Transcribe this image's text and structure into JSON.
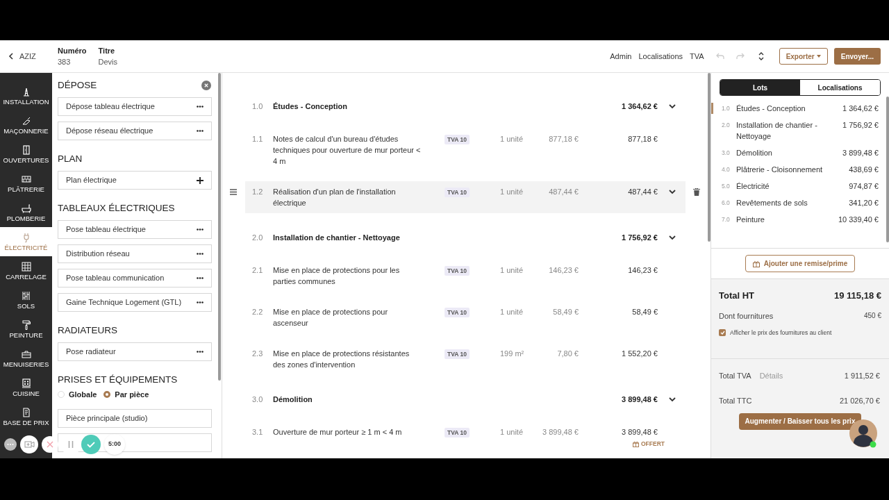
{
  "header": {
    "back_label": "AZIZ",
    "fields": [
      {
        "label": "Numéro",
        "value": "383"
      },
      {
        "label": "Titre",
        "value": "Devis"
      }
    ],
    "links": [
      "Admin",
      "Localisations",
      "TVA"
    ],
    "export_button": "Exporter",
    "send_button": "Envoyer..."
  },
  "nav": [
    {
      "label": "INSTALLATION",
      "selected": false
    },
    {
      "label": "MAÇONNERIE",
      "selected": false
    },
    {
      "label": "OUVERTURES",
      "selected": false
    },
    {
      "label": "PLÂTRERIE",
      "selected": false
    },
    {
      "label": "PLOMBERIE",
      "selected": false
    },
    {
      "label": "ÉLECTRICITÉ",
      "selected": true
    },
    {
      "label": "CARRELAGE",
      "selected": false
    },
    {
      "label": "SOLS",
      "selected": false
    },
    {
      "label": "PEINTURE",
      "selected": false
    },
    {
      "label": "MENUISERIES",
      "selected": false
    },
    {
      "label": "CUISINE",
      "selected": false
    },
    {
      "label": "BASE DE PRIX",
      "selected": false
    }
  ],
  "catalog": {
    "sections": [
      {
        "title": "DÉPOSE",
        "closable": true,
        "items": [
          {
            "label": "Dépose tableau électrique",
            "kind": "menu"
          },
          {
            "label": "Dépose réseau électrique",
            "kind": "menu"
          }
        ]
      },
      {
        "title": "PLAN",
        "closable": false,
        "items": [
          {
            "label": "Plan électrique",
            "kind": "add"
          }
        ]
      },
      {
        "title": "TABLEAUX ÉLECTRIQUES",
        "closable": false,
        "items": [
          {
            "label": "Pose tableau électrique",
            "kind": "menu"
          },
          {
            "label": "Distribution réseau",
            "kind": "menu"
          },
          {
            "label": "Pose tableau communication",
            "kind": "menu"
          },
          {
            "label": "Gaine Technique Logement (GTL)",
            "kind": "menu"
          }
        ]
      },
      {
        "title": "RADIATEURS",
        "closable": false,
        "items": [
          {
            "label": "Pose radiateur",
            "kind": "menu"
          }
        ]
      },
      {
        "title": "PRISES ET ÉQUIPEMENTS",
        "closable": false,
        "options": [
          {
            "label": "Globale",
            "selected": false
          },
          {
            "label": "Par pièce",
            "selected": true
          }
        ],
        "items": [
          {
            "label": "Pièce principale (studio)",
            "kind": "field"
          },
          {
            "kind": "field"
          }
        ]
      }
    ]
  },
  "lines": [
    {
      "kind": "lot",
      "number": "1.0",
      "title": "Études - Conception",
      "total": "1 364,62 €"
    },
    {
      "kind": "item",
      "number": "1.1",
      "title": "Notes de calcul d'un bureau d'études techniques pour ouverture de mur porteur < 4 m",
      "tva": "TVA 10",
      "quantity": "1 unité",
      "unit_price": "877,18 €",
      "total": "877,18 €",
      "hovered": false
    },
    {
      "kind": "item",
      "number": "1.2",
      "title": "Réalisation d'un plan de l'installation électrique",
      "tva": "TVA 10",
      "quantity": "1 unité",
      "unit_price": "487,44 €",
      "total": "487,44 €",
      "hovered": true
    },
    {
      "kind": "lot",
      "number": "2.0",
      "title": "Installation de chantier - Nettoyage",
      "total": "1 756,92 €"
    },
    {
      "kind": "item",
      "number": "2.1",
      "title": "Mise en place de protections pour les parties communes",
      "tva": "TVA 10",
      "quantity": "1 unité",
      "unit_price": "146,23 €",
      "total": "146,23 €",
      "hovered": false
    },
    {
      "kind": "item",
      "number": "2.2",
      "title": "Mise en place de protections pour ascenseur",
      "tva": "TVA 10",
      "quantity": "1 unité",
      "unit_price": "58,49 €",
      "total": "58,49 €",
      "hovered": false
    },
    {
      "kind": "item",
      "number": "2.3",
      "title": "Mise en place de protections résistantes des zones d'intervention",
      "tva": "TVA 10",
      "quantity": "199 m²",
      "unit_price": "7,80 €",
      "total": "1 552,20 €",
      "hovered": false
    },
    {
      "kind": "lot",
      "number": "3.0",
      "title": "Démolition",
      "total": "3 899,48 €"
    },
    {
      "kind": "item",
      "number": "3.1",
      "title": "Ouverture de mur porteur ≥ 1 m < 4 m",
      "tva": "TVA 10",
      "quantity": "1 unité",
      "unit_price": "3 899,48 €",
      "total": "3 899,48 €",
      "hovered": false,
      "offered_label": "OFFERT"
    }
  ],
  "summary": {
    "tabs": [
      {
        "label": "Lots",
        "selected": true
      },
      {
        "label": "Localisations",
        "selected": false
      }
    ],
    "lots": [
      {
        "number": "1.0",
        "title": "Études - Conception",
        "amount": "1 364,62 €",
        "selected": true
      },
      {
        "number": "2.0",
        "title": "Installation de chantier - Nettoyage",
        "amount": "1 756,92 €",
        "selected": false
      },
      {
        "number": "3.0",
        "title": "Démolition",
        "amount": "3 899,48 €",
        "selected": false
      },
      {
        "number": "4.0",
        "title": "Plâtrerie - Cloisonnement",
        "amount": "438,69 €",
        "selected": false
      },
      {
        "number": "5.0",
        "title": "Électricité",
        "amount": "974,87 €",
        "selected": false
      },
      {
        "number": "6.0",
        "title": "Revêtements de sols",
        "amount": "341,20 €",
        "selected": false
      },
      {
        "number": "7.0",
        "title": "Peinture",
        "amount": "10 339,40 €",
        "selected": false
      }
    ],
    "discount_button": "Ajouter une remise/prime",
    "total_ht": {
      "label": "Total HT",
      "value": "19 115,18 €"
    },
    "supplies": {
      "label": "Dont fournitures",
      "value": "450 €"
    },
    "show_supplies": {
      "label": "Afficher le prix des fournitures au client",
      "checked": true
    },
    "total_tva": {
      "label": "Total TVA",
      "link": "Détails",
      "value": "1 911,52 €"
    },
    "total_ttc": {
      "label": "Total TTC",
      "value": "21 026,70 €"
    },
    "adjust_button": "Augmenter / Baisser tous les prix"
  },
  "recorder": {
    "timer": "5:00"
  }
}
